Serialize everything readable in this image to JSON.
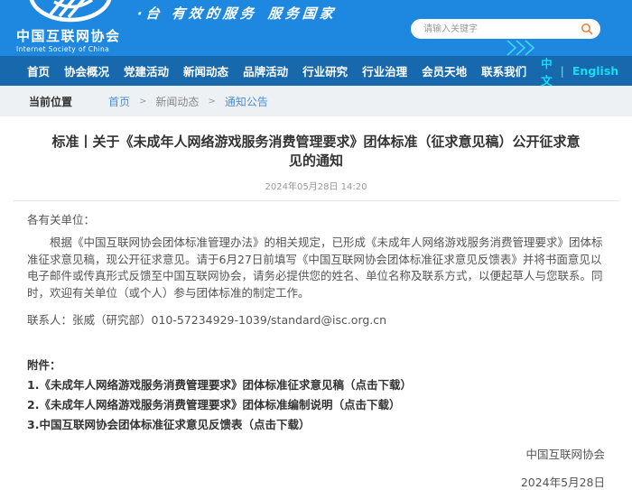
{
  "header": {
    "org_name_cn": "中国互联网协会",
    "org_name_en": "Internet Society of China",
    "slogan_left": "·台  有效的服务",
    "slogan_right": "服务国家",
    "search_placeholder": "请输入关键字"
  },
  "nav": {
    "items": [
      "首页",
      "协会概况",
      "党建活动",
      "新闻动态",
      "品牌活动",
      "行业研究",
      "行业治理",
      "会员天地",
      "联系我们"
    ],
    "lang_cn": "中文",
    "lang_divider": "|",
    "lang_en": "English"
  },
  "breadcrumb": {
    "label": "当前位置",
    "home": "首页",
    "sep1": ">",
    "section": "新闻动态",
    "sep2": ">",
    "current": "通知公告"
  },
  "article": {
    "title": "标准丨关于《未成年人网络游戏服务消费管理要求》团体标准（征求意见稿）公开征求意见的通知",
    "datetime": "2024年05月28日 14:20",
    "salutation": "各有关单位：",
    "paragraph1": "根据《中国互联网协会团体标准管理办法》的相关规定，已形成《未成年人网络游戏服务消费管理要求》团体标准征求意见稿，现公开征求意见。请于6月27日前填写《中国互联网协会团体标准征求意见反馈表》并将书面意见以电子邮件或传真形式反馈至中国互联网协会，请务必提供您的姓名、单位名称及联系方式，以便起草人与您联系。同时，欢迎有关单位（或个人）参与团体标准的制定工作。",
    "contact": "联系人：张威（研究部）010-57234929-1039/standard@isc.org.cn",
    "attachments_label": "附件：",
    "attachments": [
      "1.《未成年人网络游戏服务消费管理要求》团体标准征求意见稿（点击下载）",
      "2.《未成年人网络游戏服务消费管理要求》团体标准编制说明（点击下载）",
      "3.中国互联网协会团体标准征求意见反馈表（点击下载）"
    ],
    "signature_org": "中国互联网协会",
    "signature_date": "2024年5月28日"
  },
  "colors": {
    "header_blue": "#1e88e0",
    "nav_blue": "#1768ad",
    "accent_cyan": "#12dff5",
    "link_blue": "#4a90d9",
    "breadcrumb_bg": "#eef1f4",
    "search_icon_orange": "#f0813f"
  }
}
